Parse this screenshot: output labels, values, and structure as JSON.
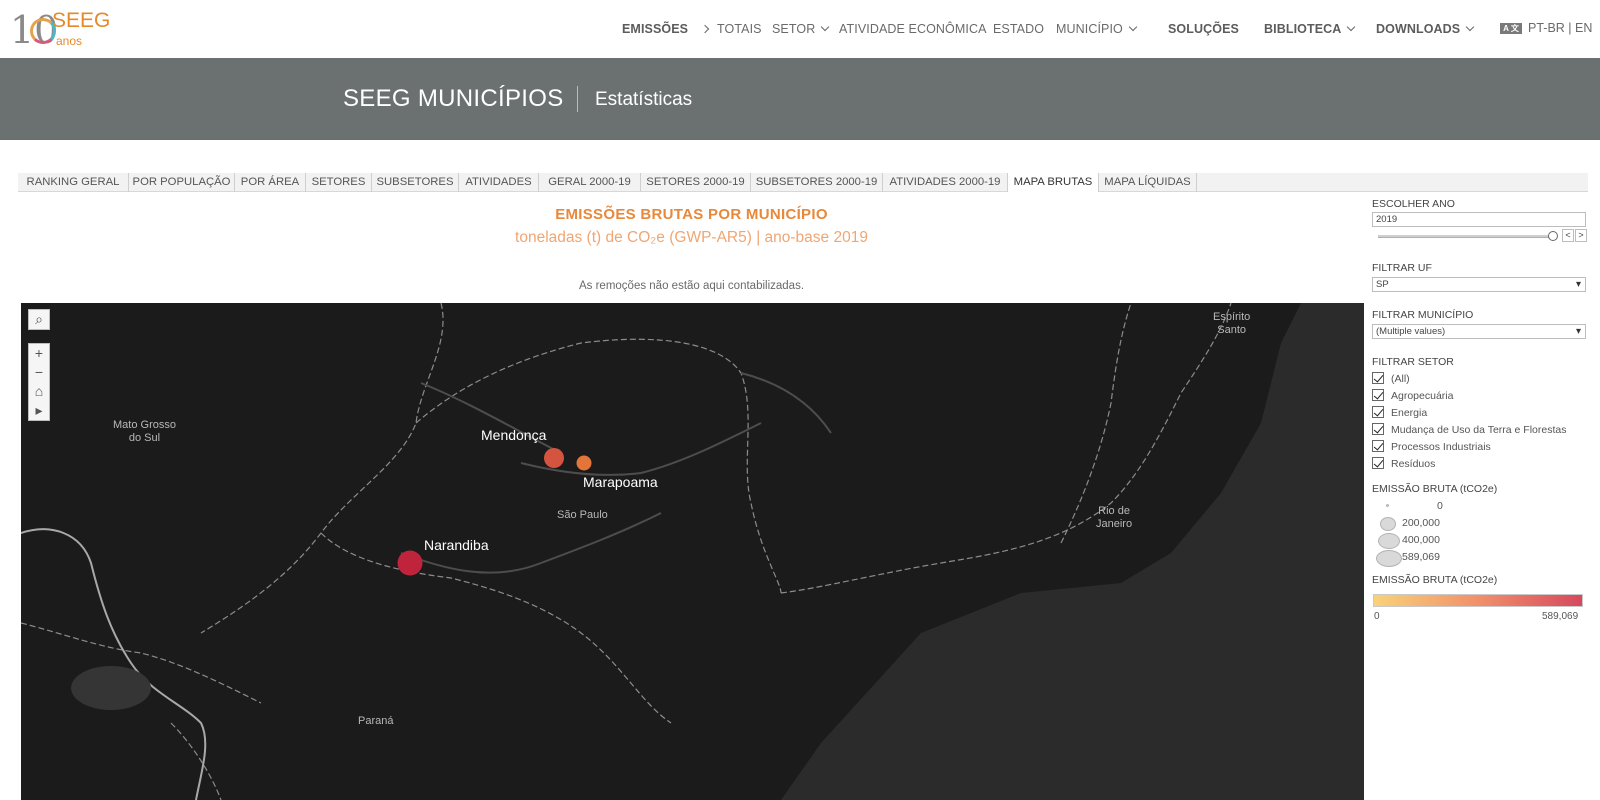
{
  "brand": {
    "ten": "10",
    "name": "SEEG",
    "sub": "anos"
  },
  "nav": {
    "emissoes": "EMISSÕES",
    "totais": "TOTAIS",
    "setor": "SETOR",
    "atividade": "ATIVIDADE ECONÔMICA",
    "estado": "ESTADO",
    "municipio": "MUNICÍPIO",
    "solucoes": "SOLUÇÕES",
    "biblioteca": "BIBLIOTECA",
    "downloads": "DOWNLOADS",
    "lang_icon": "A 文",
    "lang_pt": "PT-BR",
    "lang_sep": "|",
    "lang_en": "EN"
  },
  "banner": {
    "title": "SEEG MUNICÍPIOS",
    "subtitle": "Estatísticas"
  },
  "tabs": [
    "RANKING GERAL",
    "POR POPULAÇÃO",
    "POR ÁREA",
    "SETORES",
    "SUBSETORES",
    "ATIVIDADES",
    "GERAL 2000-19",
    "SETORES 2000-19",
    "SUBSETORES 2000-19",
    "ATIVIDADES 2000-19",
    "MAPA BRUTAS",
    "MAPA LÍQUIDAS"
  ],
  "active_tab": "MAPA BRUTAS",
  "map": {
    "title": "EMISSÕES BRUTAS POR MUNICÍPIO",
    "subtitle": "toneladas (t) de CO₂e (GWP-AR5) | ano-base 2019",
    "note": "As remoções não estão aqui contabilizadas.",
    "controls": {
      "search": "⌕",
      "zoom_in": "+",
      "zoom_out": "−",
      "home": "⌂",
      "play": "▸"
    },
    "regions": {
      "ms": "Mato Grosso\ndo Sul",
      "sp": "São Paulo",
      "pr": "Paraná",
      "es": "Espírito\nSanto",
      "rj": "Rio de\nJaneiro"
    },
    "municipalities": [
      {
        "name": "Mendonça",
        "color": "#d4543f"
      },
      {
        "name": "Marapoama",
        "color": "#e3743a"
      },
      {
        "name": "Narandiba",
        "color": "#c0243d"
      }
    ],
    "colors": {
      "background": "#1c1c1c",
      "land": "#262626",
      "border": "#9a9a9a"
    }
  },
  "sidebar": {
    "year_label": "ESCOLHER ANO",
    "year_value": "2019",
    "year_prev": "<",
    "year_next": ">",
    "uf_label": "FILTRAR UF",
    "uf_value": "SP",
    "mun_label": "FILTRAR MUNICÍPIO",
    "mun_value": "(Multiple values)",
    "setor_label": "FILTRAR SETOR",
    "setores": [
      "(All)",
      "Agropecuária",
      "Energia",
      "Mudança de Uso da Terra e Florestas",
      "Processos Industriais",
      "Resíduos"
    ],
    "size_legend_label": "EMISSÃO BRUTA (tCO2e)",
    "size_legend": [
      "0",
      "200,000",
      "400,000",
      "589,069"
    ],
    "color_legend_label": "EMISSÃO BRUTA (tCO2e)",
    "color_min": "0",
    "color_max": "589,069",
    "gradient": {
      "from": "#f8d27a",
      "mid": "#f1906b",
      "to": "#d6495e"
    }
  }
}
